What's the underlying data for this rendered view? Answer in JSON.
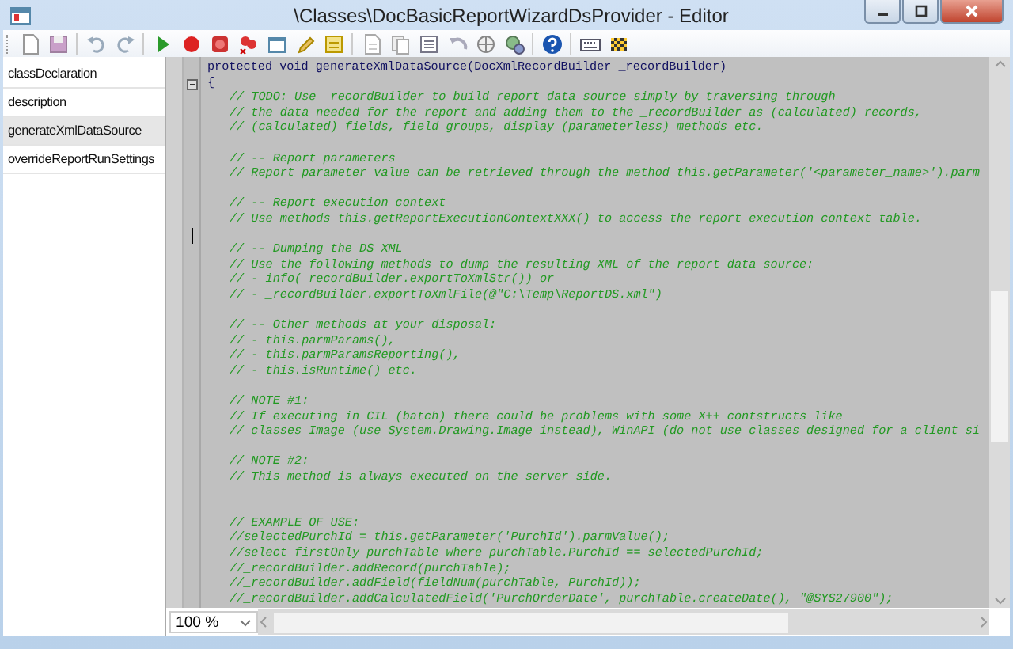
{
  "window": {
    "title": "\\Classes\\DocBasicReportWizardDsProvider - Editor"
  },
  "methods": [
    {
      "label": "classDeclaration",
      "selected": false
    },
    {
      "label": "description",
      "selected": false
    },
    {
      "label": "generateXmlDataSource",
      "selected": true
    },
    {
      "label": "overrideReportRunSettings",
      "selected": false
    }
  ],
  "editor": {
    "lines": [
      {
        "kind": "code",
        "text": "protected void generateXmlDataSource(DocXmlRecordBuilder _recordBuilder)"
      },
      {
        "kind": "brace",
        "text": "{"
      },
      {
        "kind": "comment",
        "text": "// TODO: Use _recordBuilder to build report data source simply by traversing through"
      },
      {
        "kind": "comment",
        "text": "// the data needed for the report and adding them to the _recordBuilder as (calculated) records,"
      },
      {
        "kind": "comment",
        "text": "// (calculated) fields, field groups, display (parameterless) methods etc."
      },
      {
        "kind": "blank"
      },
      {
        "kind": "comment",
        "text": "// -- Report parameters"
      },
      {
        "kind": "comment",
        "text": "// Report parameter value can be retrieved through the method this.getParameter('<parameter_name>').parm"
      },
      {
        "kind": "blank"
      },
      {
        "kind": "comment",
        "text": "// -- Report execution context"
      },
      {
        "kind": "comment",
        "text": "// Use methods this.getReportExecutionContextXXX() to access the report execution context table."
      },
      {
        "kind": "blank",
        "caret": true
      },
      {
        "kind": "comment",
        "text": "// -- Dumping the DS XML"
      },
      {
        "kind": "comment",
        "text": "// Use the following methods to dump the resulting XML of the report data source:"
      },
      {
        "kind": "comment",
        "text": "// - info(_recordBuilder.exportToXmlStr()) or"
      },
      {
        "kind": "comment",
        "text": "// - _recordBuilder.exportToXmlFile(@\"C:\\Temp\\ReportDS.xml\")"
      },
      {
        "kind": "blank"
      },
      {
        "kind": "comment",
        "text": "// -- Other methods at your disposal:"
      },
      {
        "kind": "comment",
        "text": "// - this.parmParams(),"
      },
      {
        "kind": "comment",
        "text": "// - this.parmParamsReporting(),"
      },
      {
        "kind": "comment",
        "text": "// - this.isRuntime() etc."
      },
      {
        "kind": "blank"
      },
      {
        "kind": "comment",
        "text": "// NOTE #1:"
      },
      {
        "kind": "comment",
        "text": "// If executing in CIL (batch) there could be problems with some X++ contstructs like"
      },
      {
        "kind": "comment",
        "text": "// classes Image (use System.Drawing.Image instead), WinAPI (do not use classes designed for a client si"
      },
      {
        "kind": "blank"
      },
      {
        "kind": "comment",
        "text": "// NOTE #2:"
      },
      {
        "kind": "comment",
        "text": "// This method is always executed on the server side."
      },
      {
        "kind": "blank"
      },
      {
        "kind": "blank"
      },
      {
        "kind": "comment",
        "text": "// EXAMPLE OF USE:"
      },
      {
        "kind": "comment",
        "text": "//selectedPurchId = this.getParameter('PurchId').parmValue();"
      },
      {
        "kind": "comment",
        "text": "//select firstOnly purchTable where purchTable.PurchId == selectedPurchId;"
      },
      {
        "kind": "comment",
        "text": "//_recordBuilder.addRecord(purchTable);"
      },
      {
        "kind": "comment",
        "text": "//_recordBuilder.addField(fieldNum(purchTable, PurchId));"
      },
      {
        "kind": "comment",
        "text": "//_recordBuilder.addCalculatedField('PurchOrderDate', purchTable.createDate(), \"@SYS27900\");"
      }
    ]
  },
  "zoom": {
    "value": "100 %"
  }
}
